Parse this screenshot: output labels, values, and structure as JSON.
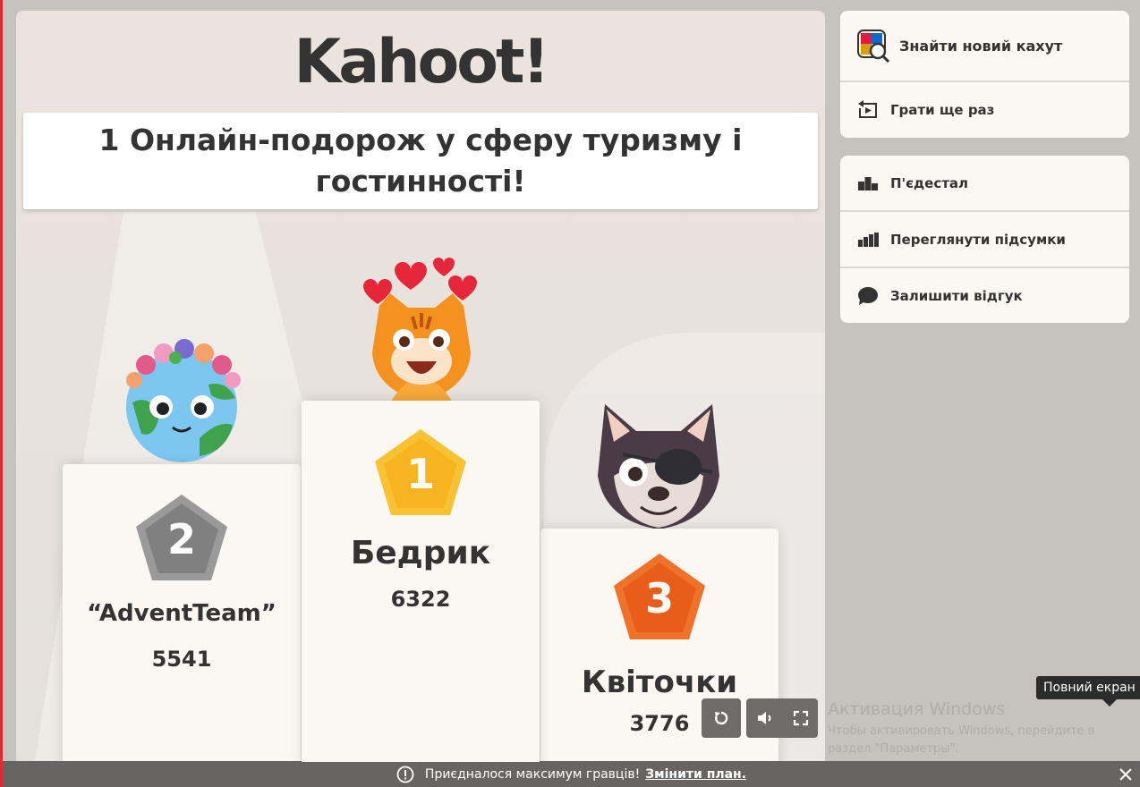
{
  "logo": "Kahoot!",
  "quiz_title": "1 Онлайн-подорож у сферу туризму і гостинності!",
  "podium": {
    "first": {
      "rank": "1",
      "name": "Бедрик",
      "score": "6322"
    },
    "second": {
      "rank": "2",
      "name": "“AdventTeam”",
      "score": "5541"
    },
    "third": {
      "rank": "3",
      "name": "Квіточки",
      "score": "3776"
    }
  },
  "sidebar": {
    "find_new": "Знайти новий кахут",
    "play_again": "Грати ще раз",
    "podium": "П'єдестал",
    "view_results": "Переглянути підсумки",
    "feedback": "Залишити відгук"
  },
  "tooltip": "Повний екран",
  "windows_watermark": {
    "title": "Активация Windows",
    "text": "Чтобы активировать Windows, перейдите в раздел \"Параметры\"."
  },
  "banner": {
    "text": "Приєдналося максимум гравців!",
    "link": "Змінити план."
  },
  "colors": {
    "gold": "#f6b51e",
    "silver": "#808080",
    "bronze": "#e85d1a"
  }
}
